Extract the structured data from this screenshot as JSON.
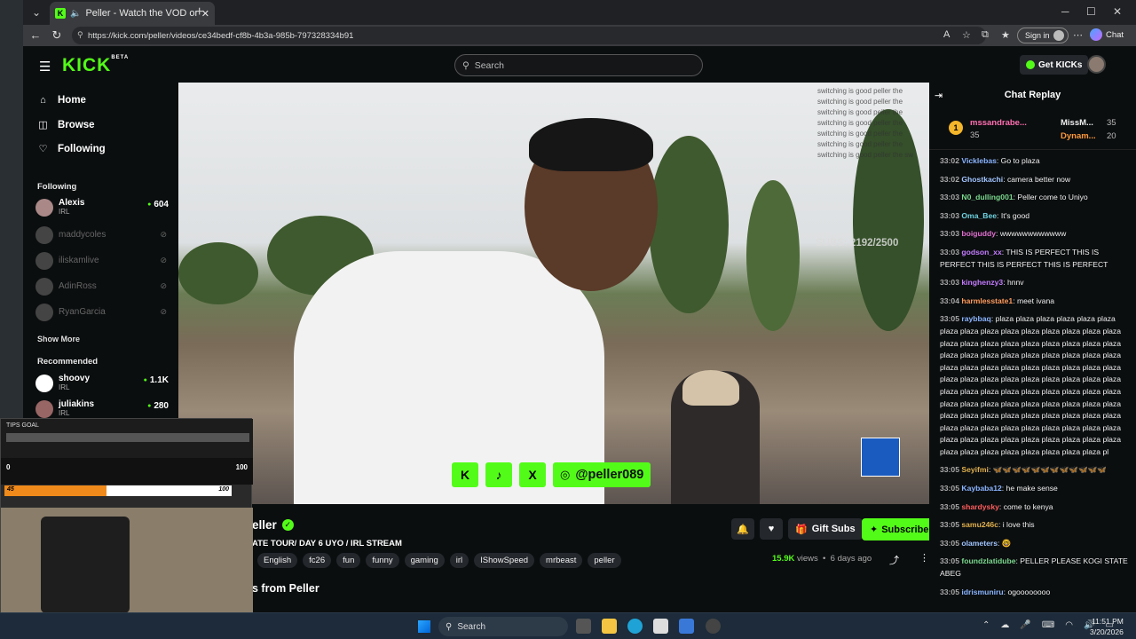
{
  "browser": {
    "tab_title": "Peller - Watch the VOD on Kic",
    "url": "https://kick.com/peller/videos/ce34bedf-cf8b-4b3a-985b-797328334b91",
    "sign_in": "Sign in",
    "chat": "Chat"
  },
  "header": {
    "logo": "KICK",
    "logo_beta": "BETA",
    "search_placeholder": "Search",
    "get_kicks": "Get KICKs"
  },
  "sidebar": {
    "nav": [
      {
        "label": "Home",
        "icon": "home-icon"
      },
      {
        "label": "Browse",
        "icon": "browse-icon"
      },
      {
        "label": "Following",
        "icon": "heart-icon"
      }
    ],
    "following_heading": "Following",
    "following": [
      {
        "name": "Alexis",
        "category": "IRL",
        "viewers": "604",
        "live": true
      },
      {
        "name": "maddycoles",
        "live": false
      },
      {
        "name": "iliskamlive",
        "live": false
      },
      {
        "name": "AdinRoss",
        "live": false
      },
      {
        "name": "RyanGarcia",
        "live": false
      }
    ],
    "show_more": "Show More",
    "recommended_heading": "Recommended",
    "recommended": [
      {
        "name": "shoovy",
        "category": "IRL",
        "viewers": "1.1K"
      },
      {
        "name": "juliakins",
        "category": "IRL",
        "viewers": "280"
      }
    ]
  },
  "video": {
    "subs_overlay": "SUBS: 2192/2500",
    "overlay_lines": [
      "switching is good peller the",
      "switching is good peller the",
      "switching is good peller the",
      "switching is good peller the",
      "switching is good peller the",
      "switching is good peller the",
      "switching is good peller the sw"
    ],
    "social_k": "K",
    "social_tiktok": "♪",
    "social_x": "X",
    "instagram_handle": "@peller089"
  },
  "info": {
    "channel": "eller",
    "stream_title": "ATE TOUR/ DAY 6 UYO / IRL STREAM",
    "tags": [
      "English",
      "fc26",
      "fun",
      "funny",
      "gaming",
      "irl",
      "IShowSpeed",
      "mrbeast",
      "peller"
    ],
    "gift_subs": "Gift Subs",
    "subscribe": "Subscribe",
    "views_count": "15.9K",
    "views_label": "views",
    "age": "6 days ago",
    "videos_from": "s from Peller"
  },
  "obs": {
    "goal_title": "TIPS GOAL",
    "bar_min": "0",
    "bar_max": "100",
    "orange_left": "45",
    "orange_right": "100",
    "orange_fill": 0.45
  },
  "chat": {
    "title": "Chat Replay",
    "top_gifters": [
      {
        "rank": "1",
        "name": "mssandrabe...",
        "count": "35"
      },
      {
        "name": "MissM...",
        "count": "35"
      },
      {
        "name": "Dynam...",
        "count": "20"
      }
    ],
    "messages": [
      {
        "time": "33:02",
        "user": "Vicklebas",
        "color": "#8ab4ff",
        "text": "Go to plaza"
      },
      {
        "time": "33:02",
        "user": "Ghostkachi",
        "color": "#a0c4ff",
        "text": "camera better now"
      },
      {
        "time": "33:03",
        "user": "N0_dulling001",
        "color": "#7bd88f",
        "text": "Peller come to Uniyo"
      },
      {
        "time": "33:03",
        "user": "Oma_Bee",
        "color": "#6fd3e0",
        "text": "It's good"
      },
      {
        "time": "33:03",
        "user": "boiguddy",
        "color": "#e06fd0",
        "text": "wwwwwwwwwwww"
      },
      {
        "time": "33:03",
        "user": "godson_xx",
        "color": "#c47cff",
        "text": "THIS IS PERFECT THIS IS PERFECT THIS IS PERFECT THIS IS PERFECT"
      },
      {
        "time": "33:03",
        "user": "kinghenzy3",
        "color": "#c47cff",
        "text": "hnnv"
      },
      {
        "time": "33:04",
        "user": "harmlesstate1",
        "color": "#ff9a5c",
        "text": "meet ivana"
      },
      {
        "time": "33:05",
        "user": "raybbaq",
        "color": "#8ab4ff",
        "text": "plaza plaza plaza plaza plaza plaza plaza plaza plaza plaza plaza plaza plaza plaza plaza plaza plaza plaza plaza plaza plaza plaza plaza plaza plaza plaza plaza plaza plaza plaza plaza plaza plaza plaza plaza plaza plaza plaza plaza plaza plaza plaza plaza plaza plaza plaza plaza plaza plaza plaza plaza plaza plaza plaza plaza plaza plaza plaza plaza plaza plaza plaza plaza plaza plaza plaza plaza plaza plaza plaza plaza plaza plaza plaza plaza plaza plaza plaza plaza plaza plaza plaza plaza plaza plaza plaza plaza plaza plaza plaza plaza plaza plaza plaza plaza plaza plaza plaza plaza plaza plaza plaza plaza plaza pl"
      },
      {
        "time": "33:05",
        "user": "Seyifmi",
        "color": "#e0b04f",
        "text": "🦋🦋🦋🦋🦋🦋🦋🦋🦋🦋🦋🦋"
      },
      {
        "time": "33:05",
        "user": "Kaybaba12",
        "color": "#8ab4ff",
        "text": "he make sense"
      },
      {
        "time": "33:05",
        "user": "shardysky",
        "color": "#ff5c5c",
        "text": "come to kenya"
      },
      {
        "time": "33:05",
        "user": "samu246c",
        "color": "#e0b04f",
        "text": "i love this"
      },
      {
        "time": "33:05",
        "user": "olameters",
        "color": "#a0c4ff",
        "text": "🤓"
      },
      {
        "time": "33:05",
        "user": "foundzlatidube",
        "color": "#7bd88f",
        "text": "PELLER PLEASE KOGI STATE ABEG"
      },
      {
        "time": "33:05",
        "user": "idrismuniru",
        "color": "#8ab4ff",
        "text": "ogoooooooo"
      }
    ]
  },
  "taskbar": {
    "search": "Search",
    "time": "11:51 PM",
    "date": "3/20/2026"
  }
}
